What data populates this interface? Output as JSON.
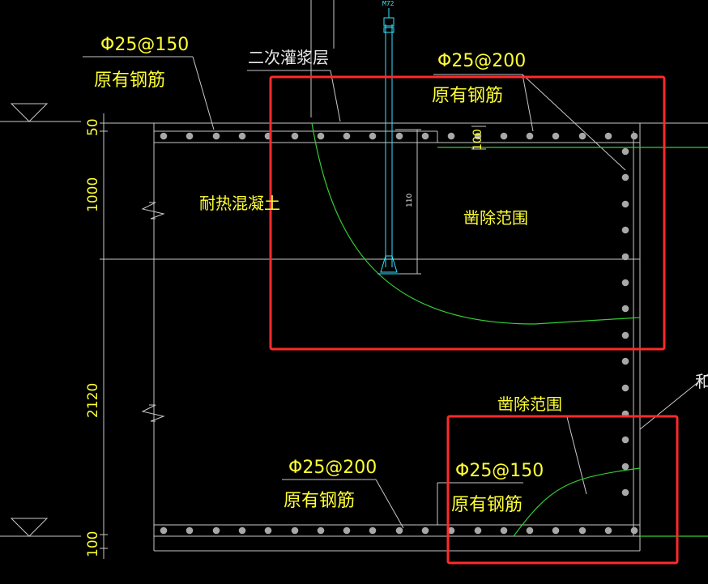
{
  "drawing": {
    "texts": {
      "rebar_top_left_spec": "Φ25@150",
      "rebar_top_left_note": "原有钢筋",
      "grout_layer": "二次灌浆层",
      "rebar_top_right_spec": "Φ25@200",
      "rebar_top_right_note": "原有钢筋",
      "heat_resistant_concrete": "耐热混凝土",
      "removal_area_top": "凿除范围",
      "removal_area_bottom": "凿除范围",
      "rebar_bottom_left_spec": "Φ25@200",
      "rebar_bottom_left_note": "原有钢筋",
      "rebar_bottom_right_spec": "Φ25@150",
      "rebar_bottom_right_note": "原有钢筋",
      "dim_50": "50",
      "dim_1000": "1000",
      "dim_2120": "2120",
      "dim_100": "100",
      "dim_100_small": "100",
      "dim_110": "110",
      "bolt_tag": "M72",
      "cut_off_label": "和"
    },
    "colors": {
      "background": "#000000",
      "line_gray": "#c8c8c8",
      "text_yellow": "#ffff33",
      "text_white": "#e8e8e8",
      "green_curve": "#33cc33",
      "cyan_bolt": "#33e5ff",
      "highlight_red": "#ff2a2a",
      "rebar_dot": "#a8a8a8"
    }
  }
}
